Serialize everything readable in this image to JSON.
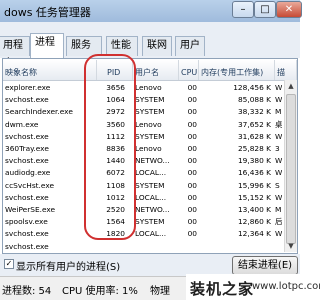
{
  "window": {
    "title": "dows 任务管理器",
    "minimize": "–",
    "maximize": "□",
    "close": "✕"
  },
  "tabs": [
    "用程序",
    "进程",
    "服务",
    "性能",
    "联网",
    "用户"
  ],
  "table": {
    "columns": [
      "映象名称",
      "PID",
      "用户名",
      "CPU",
      "内存(专用工作集)",
      "描"
    ],
    "rows": [
      [
        "explorer.exe",
        "3656",
        "Lenovo",
        "00",
        "128,456 K",
        "W"
      ],
      [
        "svchost.exe",
        "1064",
        "SYSTEM",
        "00",
        "85,088 K",
        "W"
      ],
      [
        "SearchIndexer.exe",
        "2972",
        "SYSTEM",
        "00",
        "38,332 K",
        "M"
      ],
      [
        "dwm.exe",
        "3560",
        "Lenovo",
        "00",
        "37,652 K",
        "桌"
      ],
      [
        "svchost.exe",
        "1112",
        "SYSTEM",
        "00",
        "31,628 K",
        "W"
      ],
      [
        "360Tray.exe",
        "8836",
        "Lenovo",
        "00",
        "25,828 K",
        "3"
      ],
      [
        "svchost.exe",
        "1440",
        "NETWO...",
        "00",
        "19,380 K",
        "W"
      ],
      [
        "audiodg.exe",
        "6072",
        "LOCAL...",
        "00",
        "16,436 K",
        "W"
      ],
      [
        "ccSvcHst.exe",
        "1108",
        "SYSTEM",
        "00",
        "15,996 K",
        "S"
      ],
      [
        "svchost.exe",
        "1012",
        "LOCAL...",
        "00",
        "15,152 K",
        "W"
      ],
      [
        "WeiPerSE.exe",
        "2520",
        "NETWO...",
        "00",
        "13,400 K",
        "M"
      ],
      [
        "spoolsv.exe",
        "1564",
        "SYSTEM",
        "00",
        "12,860 K",
        "后"
      ],
      [
        "svchost.exe",
        "1820",
        "LOCAL...",
        "00",
        "12,364 K",
        "W"
      ],
      [
        "svchost.exe",
        "",
        "",
        "",
        "",
        ""
      ]
    ]
  },
  "scrollbar": {
    "up": "▲",
    "down": "▼"
  },
  "bottom": {
    "checkbox_mark": "✓",
    "show_all_label": "显示所有用户的进程(S)",
    "end_process_label": "结束进程(E)"
  },
  "status": {
    "processes": "进程数: 54",
    "cpu": "CPU 使用率: 1%",
    "memory": "物理"
  },
  "watermark": {
    "text": "装机之家",
    "url": "www.lotpc.com"
  },
  "colors": {
    "highlight": "#d03030",
    "titlebar": "#b9d1ea"
  }
}
